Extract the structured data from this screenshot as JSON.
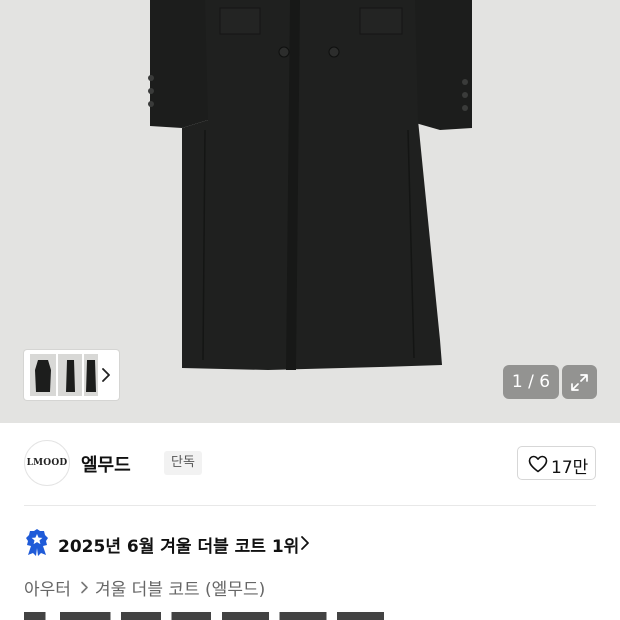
{
  "gallery": {
    "counter": "1 / 6",
    "image_count": 6,
    "current_image": 1,
    "thumbnails": [
      "coat-front",
      "coat-side",
      "coat-back"
    ],
    "next_icon": "chevron-right-icon",
    "expand_icon": "expand-icon",
    "background_color": "#e3e3e1",
    "coat_color": "#1c1d1c"
  },
  "brand": {
    "logo_text": "LMOOD",
    "name": "엘무드",
    "badge": "단독",
    "like_icon": "heart-outline-icon",
    "like_count": "17만"
  },
  "ranking": {
    "icon": "medal-star-icon",
    "text": "2025년 6월 겨울 더블 코트 1위",
    "icon_color": "#1f5bd8"
  },
  "breadcrumb": {
    "items": [
      "아우터",
      "겨울 더블 코트 (엘무드)"
    ],
    "separator_icon": "chevron-right-icon"
  }
}
